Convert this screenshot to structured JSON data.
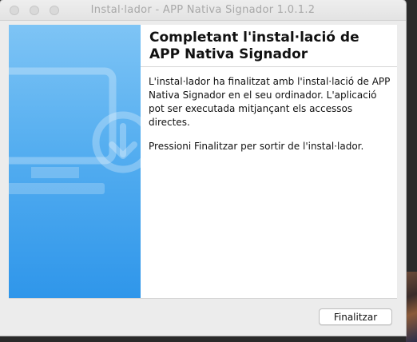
{
  "window": {
    "title": "Instal·lador - APP Nativa Signador 1.0.1.2"
  },
  "side_panel": {
    "icon": "monitor-download-icon",
    "gradient_colors": [
      "#7ec4f5",
      "#2f96ea"
    ]
  },
  "content": {
    "heading": "Completant l'instal·lació de APP Nativa Signador",
    "paragraph1": "L'instal·lador ha finalitzat amb l'instal·lació de APP Nativa Signador en el seu ordinador. L'aplicació pot ser executada mitjançant els accessos directes.",
    "paragraph2": "Pressioni Finalitzar per sortir de l'instal·lador."
  },
  "footer": {
    "finish_label": "Finalitzar"
  }
}
